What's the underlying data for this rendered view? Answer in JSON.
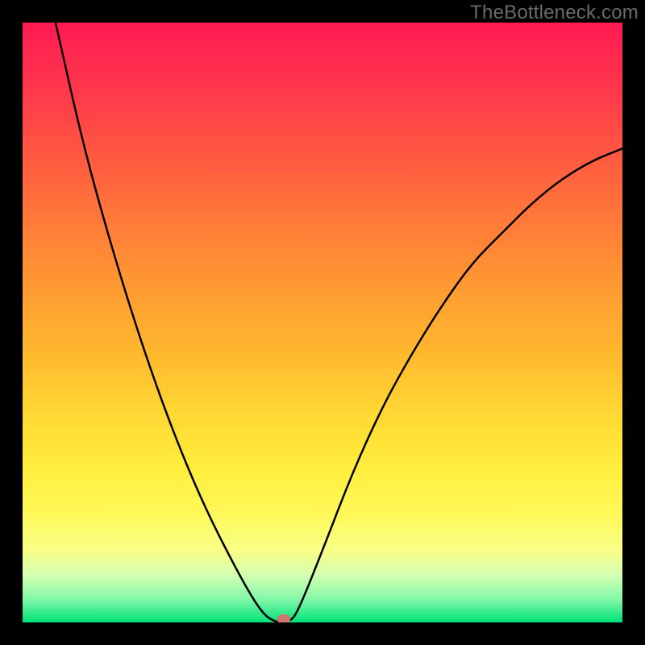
{
  "watermark": "TheBottleneck.com",
  "chart_data": {
    "type": "line",
    "title": "",
    "xlabel": "",
    "ylabel": "",
    "xlim": [
      0,
      1
    ],
    "ylim": [
      0,
      1
    ],
    "grid": false,
    "series": [
      {
        "name": "bottleneck-curve",
        "x": [
          0.055,
          0.1,
          0.15,
          0.2,
          0.25,
          0.3,
          0.35,
          0.395,
          0.42,
          0.445,
          0.46,
          0.5,
          0.55,
          0.6,
          0.65,
          0.7,
          0.75,
          0.8,
          0.85,
          0.9,
          0.95,
          1.0
        ],
        "values": [
          1.0,
          0.8,
          0.62,
          0.46,
          0.32,
          0.2,
          0.1,
          0.02,
          0.0,
          0.0,
          0.02,
          0.12,
          0.25,
          0.36,
          0.45,
          0.53,
          0.6,
          0.65,
          0.7,
          0.74,
          0.77,
          0.79
        ]
      }
    ],
    "marker": {
      "x": 0.435,
      "y": 0.0,
      "color": "#d0766c"
    },
    "background_gradient": {
      "top": "#ff1a53",
      "bottom": "#00e27a"
    }
  }
}
